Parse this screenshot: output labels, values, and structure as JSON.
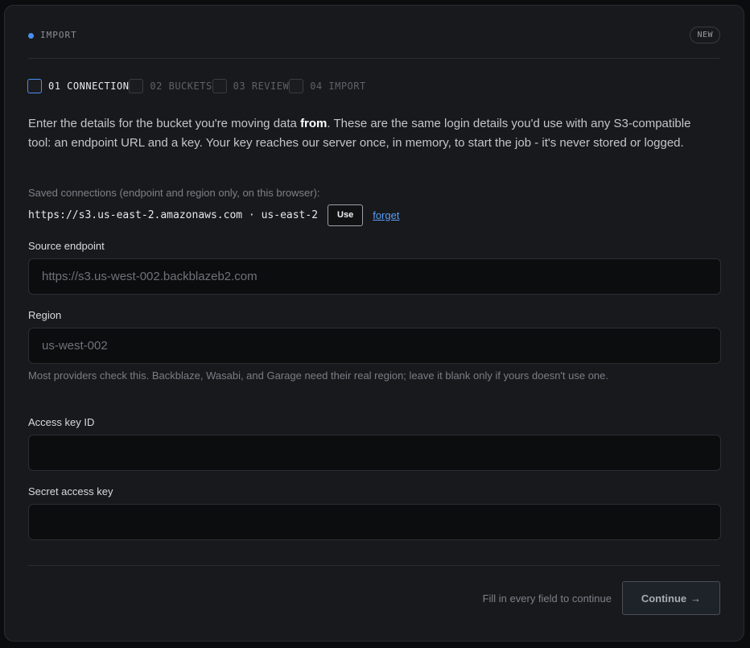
{
  "header": {
    "section_tag": "IMPORT",
    "badge": "NEW"
  },
  "steps": [
    {
      "label": "01 CONNECTION",
      "active": true
    },
    {
      "label": "02 BUCKETS",
      "active": false
    },
    {
      "label": "03 REVIEW",
      "active": false
    },
    {
      "label": "04 IMPORT",
      "active": false
    }
  ],
  "intro": {
    "before": "Enter the details for the bucket you're moving data ",
    "emphasis": "from",
    "after": ". These are the same login details you'd use with any S3-compatible tool: an endpoint URL and a key. Your key reaches our server once, in memory, to start the job - it's never stored or logged."
  },
  "saved": {
    "caption": "Saved connections (endpoint and region only, on this browser):",
    "value": "https://s3.us-east-2.amazonaws.com · us-east-2",
    "use_label": "Use",
    "forget_label": "forget"
  },
  "fields": {
    "source_endpoint": {
      "label": "Source endpoint",
      "value": "",
      "placeholder": "https://s3.us-west-002.backblazeb2.com"
    },
    "region": {
      "label": "Region",
      "value": "",
      "placeholder": "us-west-002"
    },
    "region_help": "Most providers check this. Backblaze, Wasabi, and Garage need their real region; leave it blank only if yours doesn't use one.",
    "access_key_id": {
      "label": "Access key ID",
      "value": "",
      "placeholder": ""
    },
    "secret_access_key": {
      "label": "Secret access key",
      "value": "",
      "placeholder": ""
    }
  },
  "footer": {
    "hint": "Fill in every field to continue",
    "continue_label": "Continue",
    "continue_icon": "arrow-right-icon"
  },
  "colors": {
    "accent": "#4a8ff0",
    "link": "#5b9cf4",
    "background": "#18191d"
  }
}
